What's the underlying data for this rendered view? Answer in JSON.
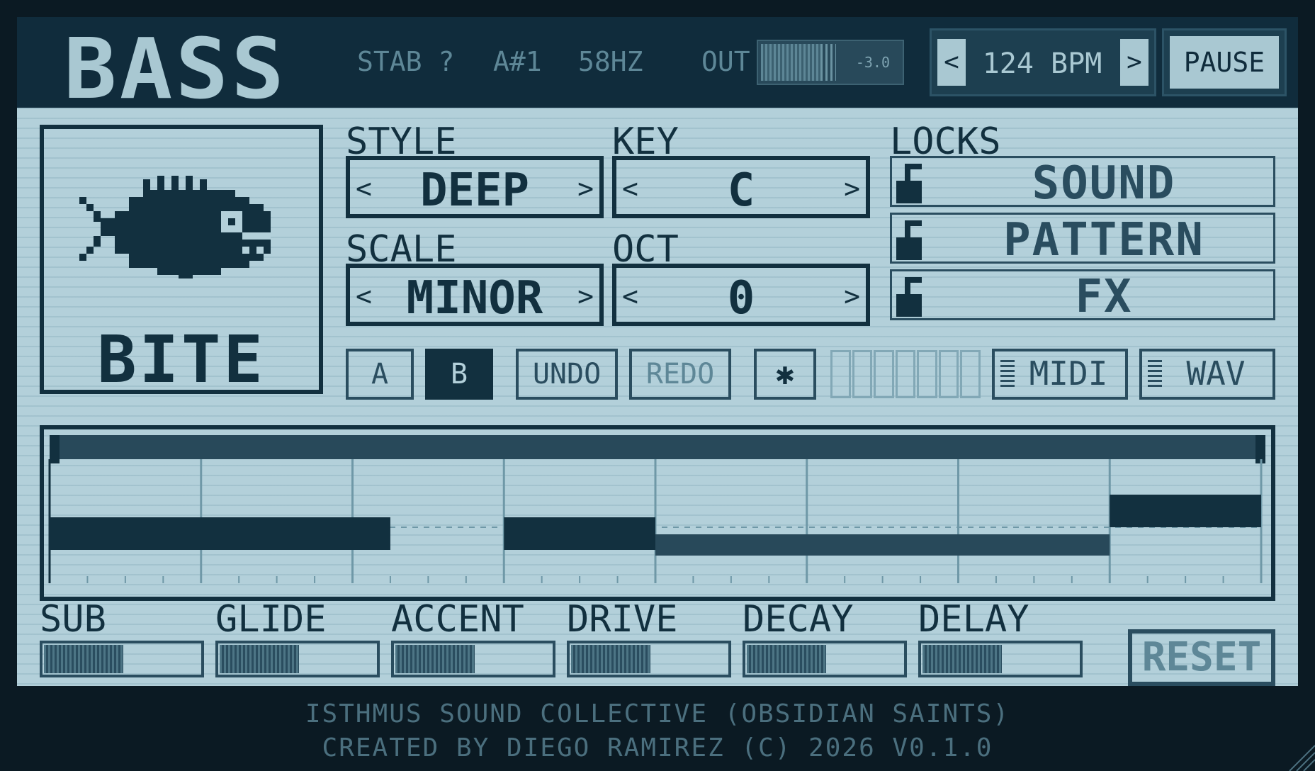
{
  "header": {
    "title": "BASS",
    "preset_type": "STAB ?",
    "note": "A#1",
    "frequency": "58HZ",
    "out_label": "OUT",
    "out_level_db": "-3.0",
    "out_level_fraction": 0.44,
    "tempo": "124 BPM",
    "tempo_prev_icon": "chevron-left-icon",
    "tempo_next_icon": "chevron-right-icon",
    "pause_label": "PAUSE"
  },
  "preset": {
    "icon": "fish-icon",
    "name": "BITE"
  },
  "params": {
    "style_label": "STYLE",
    "style_value": "DEEP",
    "key_label": "KEY",
    "key_value": "C",
    "scale_label": "SCALE",
    "scale_value": "MINOR",
    "oct_label": "OCT",
    "oct_value": "0"
  },
  "locks": {
    "title": "LOCKS",
    "items": [
      {
        "label": "SOUND",
        "locked": false
      },
      {
        "label": "PATTERN",
        "locked": false
      },
      {
        "label": "FX",
        "locked": false
      }
    ]
  },
  "toolbar": {
    "a_label": "A",
    "b_label": "B",
    "undo_label": "UNDO",
    "redo_label": "REDO",
    "random_glyph": "✱",
    "slot_count": 7,
    "midi_label": "MIDI",
    "wav_label": "WAV"
  },
  "sequencer": {
    "steps": 32,
    "notes": [
      {
        "start": 0,
        "length": 9,
        "level": 2
      },
      {
        "start": 12,
        "length": 4,
        "level": 2
      },
      {
        "start": 16,
        "length": 12,
        "level": 1
      },
      {
        "start": 28,
        "length": 4,
        "level": 3
      }
    ]
  },
  "knobs": [
    {
      "label": "SUB",
      "value": 0.5
    },
    {
      "label": "GLIDE",
      "value": 0.5
    },
    {
      "label": "ACCENT",
      "value": 0.5
    },
    {
      "label": "DRIVE",
      "value": 0.5
    },
    {
      "label": "DECAY",
      "value": 0.5
    },
    {
      "label": "DELAY",
      "value": 0.5
    }
  ],
  "reset_label": "RESET",
  "footer": {
    "line1": "ISTHMUS SOUND COLLECTIVE (OBSIDIAN SAINTS)",
    "line2": "CREATED BY DIEGO RAMIREZ  (C) 2026  V0.1.0"
  },
  "colors": {
    "background": "#0b1a23",
    "lcd": "#b3d0da",
    "ink": "#12303f",
    "header_bg": "#102c3c",
    "dim": "#5e8797"
  }
}
